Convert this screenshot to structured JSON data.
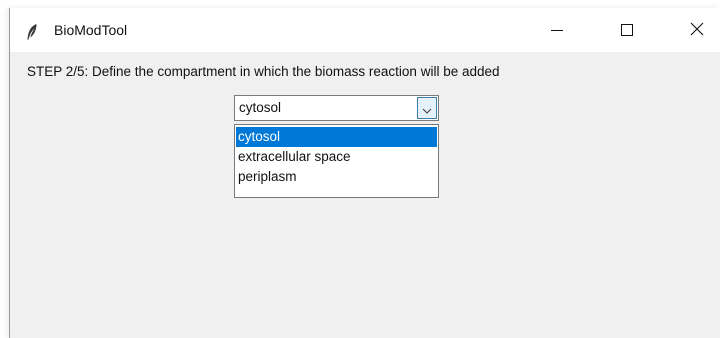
{
  "window": {
    "title": "BioModTool",
    "icon": "feather-icon",
    "controls": [
      "minimize-icon",
      "maximize-icon",
      "close-icon"
    ]
  },
  "step_label": "STEP 2/5: Define the compartment in which the biomass reaction will be added",
  "compartment_select": {
    "value": "cytosol",
    "options": [
      {
        "label": "cytosol",
        "selected": true
      },
      {
        "label": "extracellular space",
        "selected": false
      },
      {
        "label": "periplasm",
        "selected": false
      }
    ],
    "expanded": true
  },
  "colors": {
    "selection": "#0078d7",
    "window_bg": "#f0f0f0",
    "arrow_button_bg": "#e5f1fb",
    "arrow_button_border": "#3c7fb1"
  }
}
